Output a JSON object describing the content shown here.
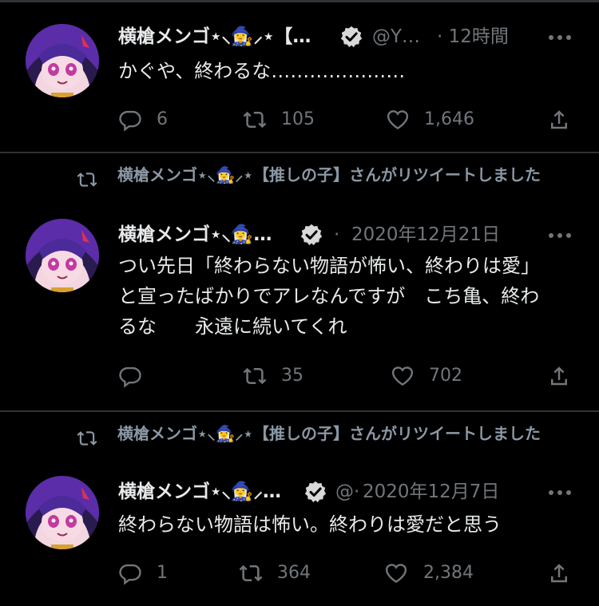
{
  "tweets": [
    {
      "retweet_text": "",
      "name": "横槍メンゴ⋆⸜🧙‍♀️⸝⋆【…",
      "handle": "@Y…",
      "time": "· 12時間",
      "body": "かぐや、終わるな…………………",
      "reply_count": "6",
      "retweet_count": "105",
      "like_count": "1,646"
    },
    {
      "retweet_text": "横槍メンゴ⋆⸜🧙‍♀️⸝⋆【推しの子】さんがリツイートしました",
      "name": "横槍メンゴ⋆⸜🧙‍♀️…",
      "handle": "·",
      "time": "2020年12月21日",
      "body": "つい先日「終わらない物語が怖い、終わりは愛」と宣ったばかりでアレなんですが　こち亀、終わるな　　永遠に続いてくれ",
      "reply_count": "",
      "retweet_count": "35",
      "like_count": "702"
    },
    {
      "retweet_text": "横槍メンゴ⋆⸜🧙‍♀️⸝⋆【推しの子】さんがリツイートしました",
      "name": "横槍メンゴ⋆⸜🧙‍♀️⸝…",
      "handle": "@·",
      "time": "2020年12月7日",
      "body": "終わらない物語は怖い。終わりは愛だと思う",
      "reply_count": "1",
      "retweet_count": "364",
      "like_count": "2,384"
    }
  ],
  "icons": {
    "reply": "reply-icon",
    "retweet": "retweet-icon",
    "like": "heart-icon",
    "share": "share-icon",
    "verified": "verified-badge-icon",
    "more": "more-options-icon"
  },
  "colors": {
    "background": "#000000",
    "text": "#e7e9ea",
    "muted": "#71767b",
    "divider": "#2f3336"
  }
}
